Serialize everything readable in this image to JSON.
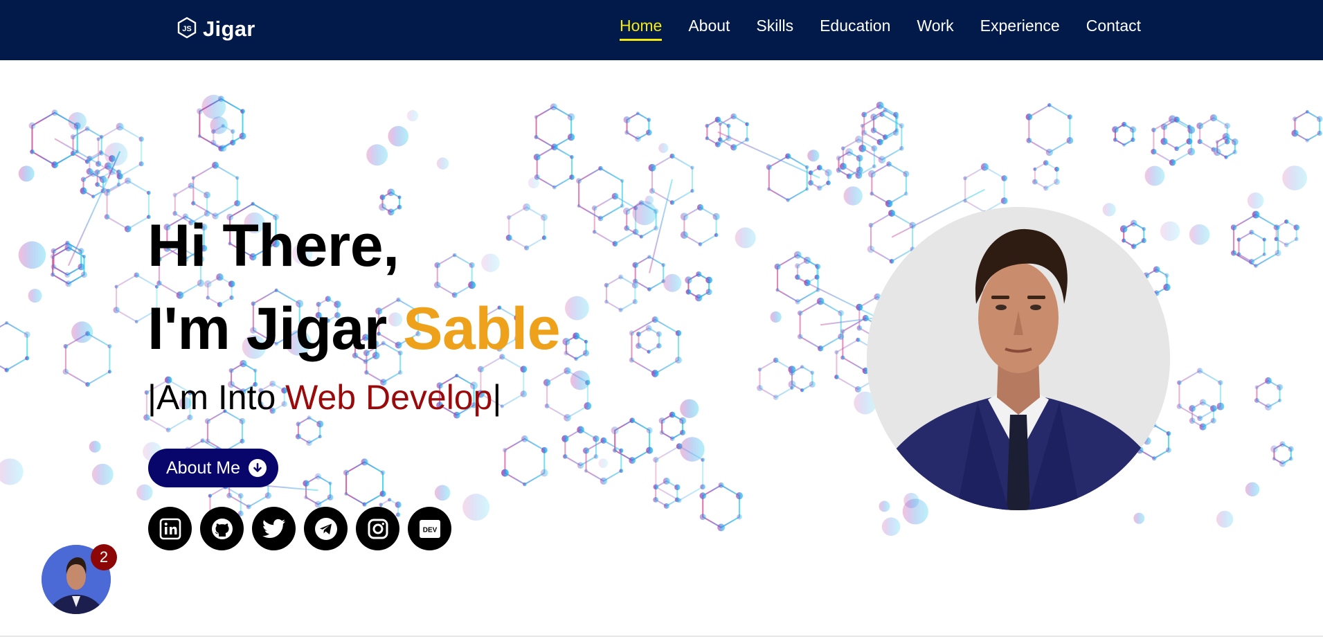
{
  "brand": {
    "name": "Jigar",
    "icon": "nodejs-hexagon-icon"
  },
  "nav": {
    "items": [
      {
        "label": "Home",
        "active": true
      },
      {
        "label": "About",
        "active": false
      },
      {
        "label": "Skills",
        "active": false
      },
      {
        "label": "Education",
        "active": false
      },
      {
        "label": "Work",
        "active": false
      },
      {
        "label": "Experience",
        "active": false
      },
      {
        "label": "Contact",
        "active": false
      }
    ]
  },
  "hero": {
    "greeting": "Hi There,",
    "name_prefix": "I'm Jigar ",
    "surname": "Sable",
    "typed_prefix": "|Am Into ",
    "typed_accent": "Web Develop",
    "typed_cursor": "|",
    "about_button": "About Me"
  },
  "socials": [
    {
      "name": "linkedin-icon",
      "label": "in"
    },
    {
      "name": "github-icon"
    },
    {
      "name": "twitter-icon"
    },
    {
      "name": "telegram-icon"
    },
    {
      "name": "instagram-icon"
    },
    {
      "name": "dev-icon",
      "label": "DEV"
    }
  ],
  "chat": {
    "badge_count": "2"
  },
  "colors": {
    "navbar": "#021a4a",
    "active_nav": "#f5e90f",
    "surname": "#eea11a",
    "typed_accent": "#9b0a0a",
    "button": "#08066a",
    "badge": "#8c0606"
  }
}
